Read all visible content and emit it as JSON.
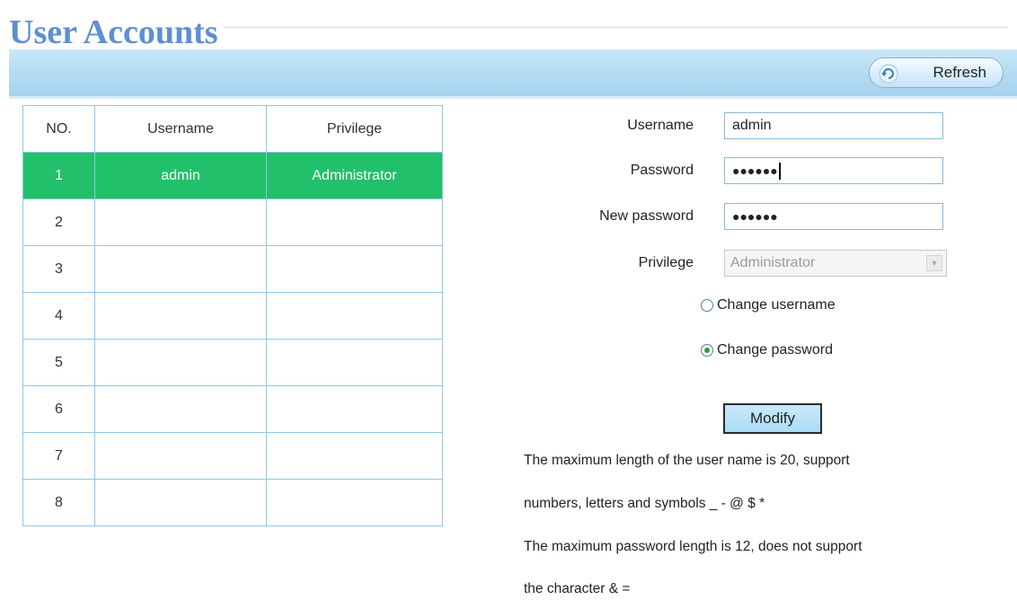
{
  "page": {
    "title": "User Accounts"
  },
  "toolbar": {
    "refresh_label": "Refresh"
  },
  "table": {
    "headers": [
      "NO.",
      "Username",
      "Privilege"
    ],
    "rows": [
      {
        "no": "1",
        "username": "admin",
        "privilege": "Administrator",
        "selected": true
      },
      {
        "no": "2",
        "username": "",
        "privilege": ""
      },
      {
        "no": "3",
        "username": "",
        "privilege": ""
      },
      {
        "no": "4",
        "username": "",
        "privilege": ""
      },
      {
        "no": "5",
        "username": "",
        "privilege": ""
      },
      {
        "no": "6",
        "username": "",
        "privilege": ""
      },
      {
        "no": "7",
        "username": "",
        "privilege": ""
      },
      {
        "no": "8",
        "username": "",
        "privilege": ""
      }
    ],
    "selected_color": "#22c06b"
  },
  "form": {
    "username_label": "Username",
    "username_value": "admin",
    "password_label": "Password",
    "password_value": "●●●●●●",
    "new_password_label": "New password",
    "new_password_value": "●●●●●●",
    "privilege_label": "Privilege",
    "privilege_value": "Administrator",
    "change_username_label": "Change username",
    "change_password_label": "Change password",
    "selected_option": "Change password",
    "modify_label": "Modify"
  },
  "notes": [
    "The maximum length of the user name is 20, support",
    "numbers, letters and symbols _ - @ $ *",
    "The maximum password length is 12, does not support",
    "the character & ="
  ],
  "colors": {
    "title": "#5d8fd3",
    "toolbar": "#b6dcf3"
  }
}
